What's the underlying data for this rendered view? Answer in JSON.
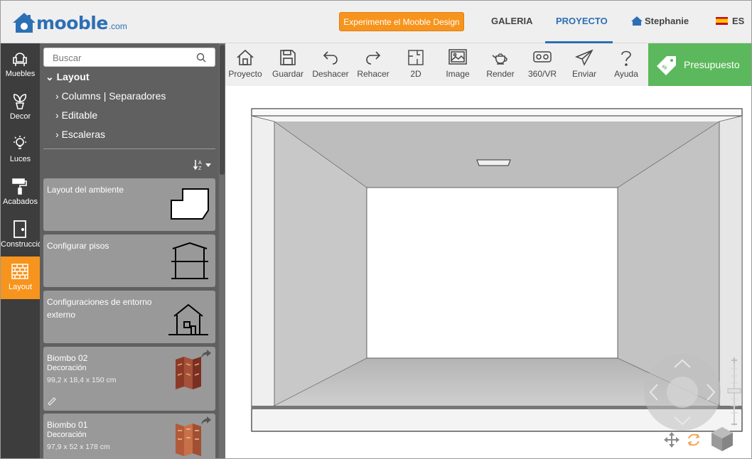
{
  "brand": {
    "logo_main": "mooble",
    "logo_suffix": ".com",
    "color": "#2d6fb5"
  },
  "header": {
    "design_button": "Experimente el Mooble Design",
    "nav_gallery": "GALERIA",
    "nav_project": "PROYECTO",
    "user_name": "Stephanie",
    "language": "ES"
  },
  "rail": {
    "items": [
      {
        "label": "Muebles",
        "icon": "armchair-icon"
      },
      {
        "label": "Decor",
        "icon": "plant-icon"
      },
      {
        "label": "Luces",
        "icon": "lightbulb-icon"
      },
      {
        "label": "Acabados",
        "icon": "paint-roller-icon"
      },
      {
        "label": "Construcción",
        "icon": "door-icon"
      },
      {
        "label": "Layout",
        "icon": "brick-wall-icon",
        "active": true
      }
    ]
  },
  "panel": {
    "search_placeholder": "Buscar",
    "tree_root": "Layout",
    "tree_children": [
      "Columns | Separadores",
      "Editable",
      "Escaleras"
    ],
    "cards": [
      {
        "title": "Layout del ambiente",
        "icon": "room-layout-icon"
      },
      {
        "title": "Configurar pisos",
        "icon": "floors-icon"
      },
      {
        "title": "Configuraciones de entorno externo",
        "icon": "house-icon"
      },
      {
        "title": "Biombo 02",
        "category": "Decoración",
        "dims": "99,2 x 18,4 x 150 cm"
      },
      {
        "title": "Biombo 01",
        "category": "Decoración",
        "dims": "97,9 x 52 x 178 cm"
      }
    ]
  },
  "toolbar": {
    "tools": [
      {
        "label": "Proyecto",
        "icon": "home-icon"
      },
      {
        "label": "Guardar",
        "icon": "save-icon"
      },
      {
        "label": "Deshacer",
        "icon": "undo-icon"
      },
      {
        "label": "Rehacer",
        "icon": "redo-icon"
      },
      {
        "label": "2D",
        "icon": "floorplan-2d-icon"
      },
      {
        "label": "Image",
        "icon": "image-icon"
      },
      {
        "label": "Render",
        "icon": "teapot-icon"
      },
      {
        "label": "360/VR",
        "icon": "vr-headset-icon"
      },
      {
        "label": "Enviar",
        "icon": "send-icon"
      },
      {
        "label": "Ayuda",
        "icon": "help-icon"
      }
    ],
    "budget_label": "Presupuesto",
    "budget_color": "#5cb85c"
  },
  "colors": {
    "accent": "#f7941d",
    "rail_bg": "#3d3d3d",
    "panel_bg": "#606060"
  }
}
